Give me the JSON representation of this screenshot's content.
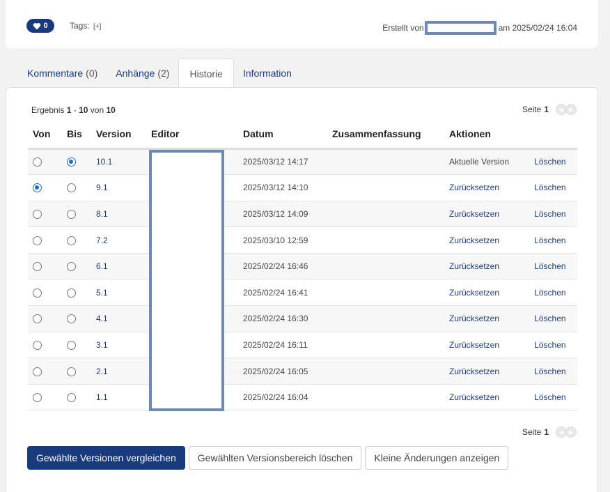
{
  "header": {
    "likes_count": "0",
    "tags_label": "Tags:",
    "tags_add": "[+]",
    "created_by_label": "Erstellt von",
    "created_on_label": "am 2025/02/24 16:04"
  },
  "tabs": [
    {
      "label": "Kommentare",
      "count": "(0)"
    },
    {
      "label": "Anhänge",
      "count": "(2)"
    },
    {
      "label": "Historie",
      "count": ""
    },
    {
      "label": "Information",
      "count": ""
    }
  ],
  "result": {
    "prefix": "Ergebnis",
    "from": "1",
    "dash": "-",
    "to": "10",
    "of_label": "von",
    "total": "10"
  },
  "pager": {
    "label": "Seite",
    "page": "1"
  },
  "table": {
    "headers": [
      "Von",
      "Bis",
      "Version",
      "Editor",
      "Datum",
      "Zusammenfassung",
      "Aktionen"
    ],
    "rows": [
      {
        "version": "10.1",
        "date": "2025/03/12 14:17",
        "action": "Aktuelle Version",
        "delete": "Löschen"
      },
      {
        "version": "9.1",
        "date": "2025/03/12 14:10",
        "action": "Zurücksetzen",
        "delete": "Löschen"
      },
      {
        "version": "8.1",
        "date": "2025/03/12 14:09",
        "action": "Zurücksetzen",
        "delete": "Löschen"
      },
      {
        "version": "7.2",
        "date": "2025/03/10 12:59",
        "action": "Zurücksetzen",
        "delete": "Löschen"
      },
      {
        "version": "6.1",
        "date": "2025/02/24 16:46",
        "action": "Zurücksetzen",
        "delete": "Löschen"
      },
      {
        "version": "5.1",
        "date": "2025/02/24 16:41",
        "action": "Zurücksetzen",
        "delete": "Löschen"
      },
      {
        "version": "4.1",
        "date": "2025/02/24 16:30",
        "action": "Zurücksetzen",
        "delete": "Löschen"
      },
      {
        "version": "3.1",
        "date": "2025/02/24 16:11",
        "action": "Zurücksetzen",
        "delete": "Löschen"
      },
      {
        "version": "2.1",
        "date": "2025/02/24 16:05",
        "action": "Zurücksetzen",
        "delete": "Löschen"
      },
      {
        "version": "1.1",
        "date": "2025/02/24 16:04",
        "action": "Zurücksetzen",
        "delete": "Löschen"
      }
    ]
  },
  "buttons": {
    "compare": "Gewählte Versionen vergleichen",
    "delete_range": "Gewählten Versionsbereich löschen",
    "minor": "Kleine Änderungen anzeigen"
  },
  "colors": {
    "accent": "#1a3a7e",
    "radio": "#1a6ec7",
    "redaction": "#6b8bb5"
  },
  "icons": {
    "likes": "heart-icon",
    "pager_prev": "chevron-left-icon",
    "pager_next": "chevron-right-icon"
  }
}
